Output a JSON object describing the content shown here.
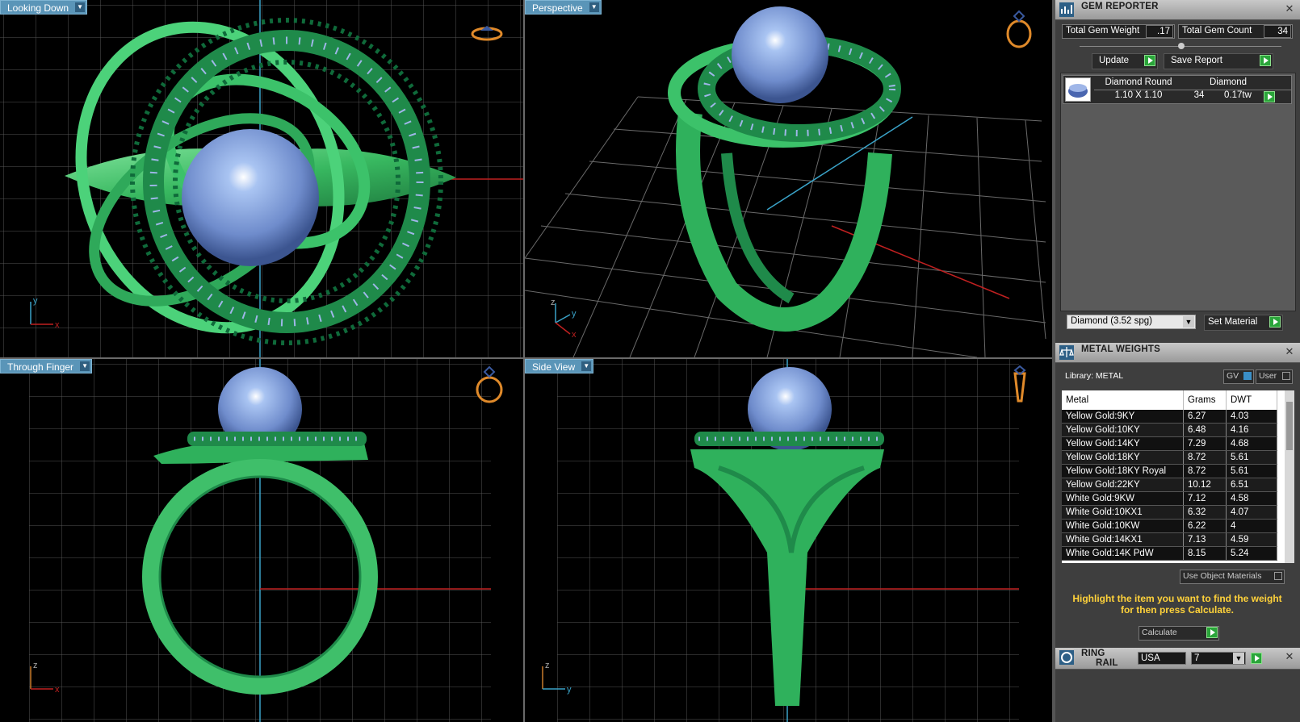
{
  "viewports": {
    "top_left": {
      "label": "Looking Down",
      "axis_a": "y",
      "axis_b": "x"
    },
    "top_right": {
      "label": "Perspective",
      "axis_a": "z",
      "axis_b": "y",
      "axis_c": "x"
    },
    "bottom_left": {
      "label": "Through Finger",
      "axis_a": "z",
      "axis_b": "x"
    },
    "bottom_right": {
      "label": "Side View",
      "axis_a": "z",
      "axis_b": "y"
    }
  },
  "gem_reporter": {
    "title": "GEM REPORTER",
    "total_weight_label": "Total Gem Weight",
    "total_weight_value": ".17",
    "total_count_label": "Total Gem Count",
    "total_count_value": "34",
    "update_label": "Update",
    "save_report_label": "Save Report",
    "columns": [
      "Diamond Round",
      "Diamond"
    ],
    "row": {
      "size": "1.10 X 1.10",
      "count": "34",
      "weight": "0.17tw"
    },
    "material_select": "Diamond    (3.52 spg)",
    "set_material_label": "Set Material"
  },
  "metal_weights": {
    "title": "METAL WEIGHTS",
    "library_label": "Library: METAL",
    "gv_label": "GV",
    "user_label": "User",
    "columns": [
      "Metal",
      "Grams",
      "DWT"
    ],
    "rows": [
      [
        "Yellow Gold:9KY",
        "6.27",
        "4.03"
      ],
      [
        "Yellow Gold:10KY",
        "6.48",
        "4.16"
      ],
      [
        "Yellow Gold:14KY",
        "7.29",
        "4.68"
      ],
      [
        "Yellow Gold:18KY",
        "8.72",
        "5.61"
      ],
      [
        "Yellow Gold:18KY Royal",
        "8.72",
        "5.61"
      ],
      [
        "Yellow Gold:22KY",
        "10.12",
        "6.51"
      ],
      [
        "White Gold:9KW",
        "7.12",
        "4.58"
      ],
      [
        "White Gold:10KX1",
        "6.32",
        "4.07"
      ],
      [
        "White Gold:10KW",
        "6.22",
        "4"
      ],
      [
        "White Gold:14KX1",
        "7.13",
        "4.59"
      ],
      [
        "White Gold:14K PdW",
        "8.15",
        "5.24"
      ]
    ],
    "use_object_materials_label": "Use Object Materials",
    "hint": "Highlight the item you want to find the weight for then press Calculate.",
    "calculate_label": "Calculate"
  },
  "ring_rail": {
    "title_line1": "RING",
    "title_line2": "RAIL",
    "region": "USA",
    "size": "7"
  },
  "colors": {
    "metal": "#3fbf6a",
    "gem": "#9fb6e8",
    "grid": "#5a5a5a",
    "label_bg": "#5a95b8",
    "hint": "#ffd23a"
  }
}
